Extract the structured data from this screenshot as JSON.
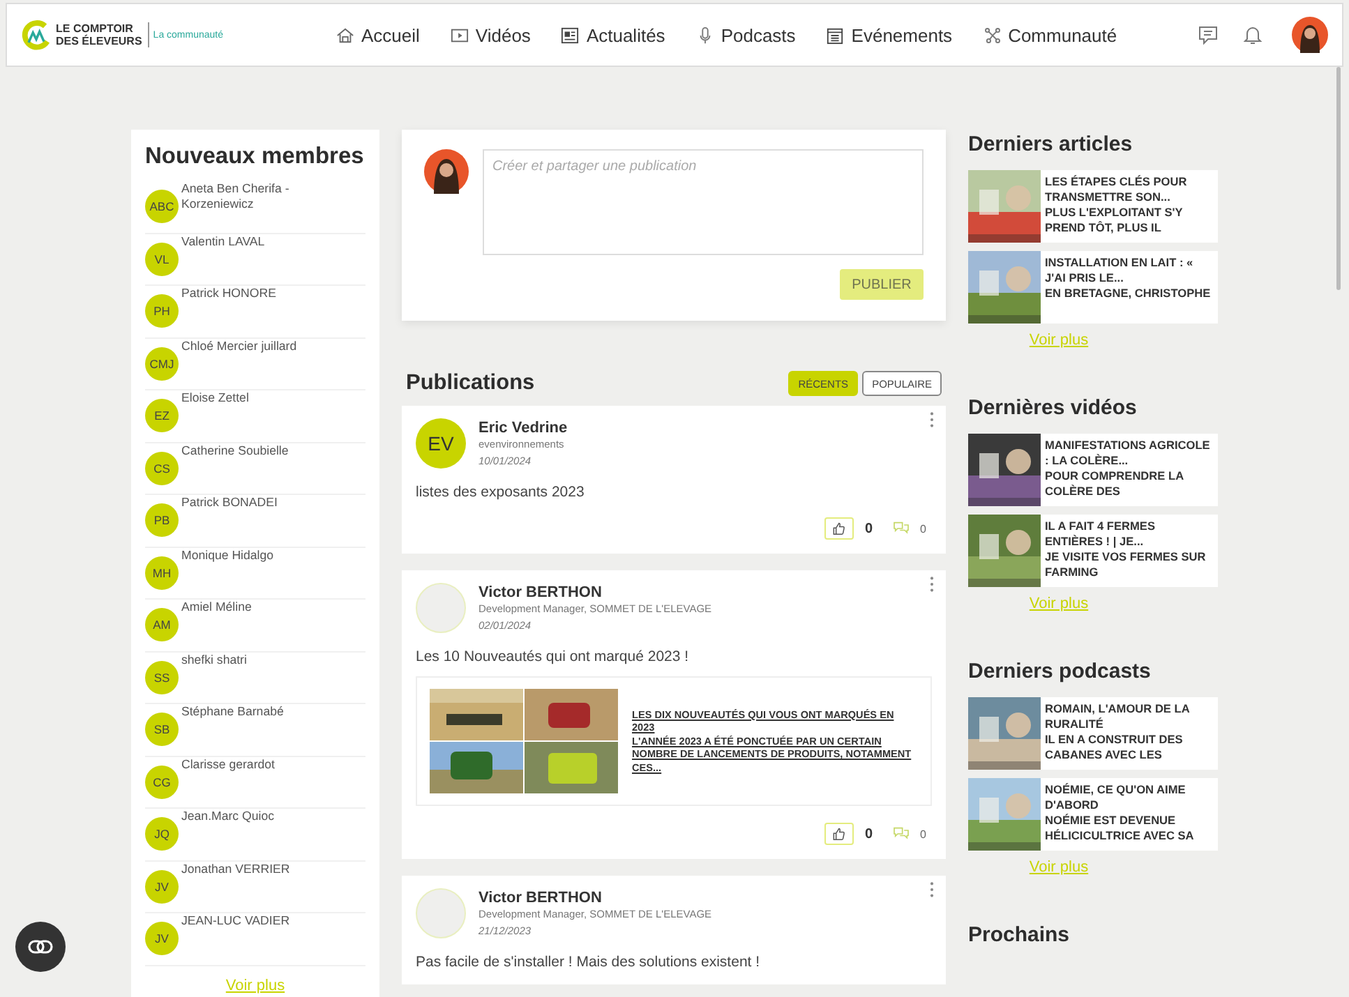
{
  "header": {
    "logo": {
      "line1": "LE COMPTOIR",
      "line2": "DES ÉLEVEURS",
      "tagline": "La communauté"
    },
    "nav": [
      {
        "label": "Accueil",
        "kind": "home"
      },
      {
        "label": "Vidéos",
        "kind": "video"
      },
      {
        "label": "Actualités",
        "kind": "news"
      },
      {
        "label": "Podcasts",
        "kind": "mic"
      },
      {
        "label": "Evénements",
        "kind": "calendar"
      },
      {
        "label": "Communauté",
        "kind": "network"
      }
    ]
  },
  "new_members": {
    "title": "Nouveaux membres",
    "more": "Voir plus",
    "items": [
      {
        "initials": "ABC",
        "name": "Aneta Ben Cherifa - Korzeniewicz"
      },
      {
        "initials": "VL",
        "name": "Valentin LAVAL"
      },
      {
        "initials": "PH",
        "name": "Patrick HONORE"
      },
      {
        "initials": "CMJ",
        "name": "Chloé Mercier juillard"
      },
      {
        "initials": "EZ",
        "name": "Eloise Zettel"
      },
      {
        "initials": "CS",
        "name": "Catherine Soubielle"
      },
      {
        "initials": "PB",
        "name": "Patrick BONADEI"
      },
      {
        "initials": "MH",
        "name": "Monique Hidalgo"
      },
      {
        "initials": "AM",
        "name": "Amiel Méline"
      },
      {
        "initials": "SS",
        "name": "shefki shatri"
      },
      {
        "initials": "SB",
        "name": "Stéphane Barnabé"
      },
      {
        "initials": "CG",
        "name": "Clarisse gerardot"
      },
      {
        "initials": "JQ",
        "name": "Jean.Marc Quioc"
      },
      {
        "initials": "JV",
        "name": "Jonathan VERRIER"
      },
      {
        "initials": "JV",
        "name": "JEAN-LUC VADIER"
      }
    ]
  },
  "composer": {
    "placeholder": "Créer et partager une publication",
    "button": "PUBLIER"
  },
  "publications": {
    "title": "Publications",
    "filters": [
      {
        "label": "RÉCENTS",
        "selected": true
      },
      {
        "label": "POPULAIRE",
        "selected": false
      }
    ],
    "posts": [
      {
        "kind": "initials",
        "initials": "EV",
        "author": "Eric Vedrine",
        "subtitle": "evenvironnements",
        "date": "10/01/2024",
        "text": "listes des exposants 2023",
        "likes": "0",
        "comments": "0"
      },
      {
        "kind": "blank",
        "author": "Victor BERTHON",
        "subtitle": "Development Manager, SOMMET DE L'ELEVAGE",
        "date": "02/01/2024",
        "text": "Les 10 Nouveautés qui ont marqué 2023 !",
        "link": {
          "kind": "picture",
          "title": "LES DIX NOUVEAUTÉS QUI VOUS ONT MARQUÉS EN 2023",
          "excerpt": "L'ANNÉE 2023 A ÉTÉ PONCTUÉE PAR UN CERTAIN NOMBRE DE LANCEMENTS DE PRODUITS, NOTAMMENT CES..."
        },
        "likes": "0",
        "comments": "0"
      },
      {
        "kind": "blank",
        "author": "Victor BERTHON",
        "subtitle": "Development Manager, SOMMET DE L'ELEVAGE",
        "date": "21/12/2023",
        "text": "Pas facile de s'installer ! Mais des solutions existent !"
      }
    ]
  },
  "sidebar": [
    {
      "title": "Derniers articles",
      "more": "Voir plus",
      "items": [
        {
          "kind": "picture",
          "title": "LES ÉTAPES CLÉS POUR TRANSMETTRE SON...",
          "excerpt": "PLUS L'EXPLOITANT S'Y PREND TÔT, PLUS IL"
        },
        {
          "kind": "picture",
          "title": "INSTALLATION EN LAIT : « J'AI PRIS LE...",
          "excerpt": "EN BRETAGNE, CHRISTOPHE"
        }
      ]
    },
    {
      "title": "Dernières vidéos",
      "more": "Voir plus",
      "items": [
        {
          "kind": "picture",
          "title": "MANIFESTATIONS AGRICOLE : LA COLÈRE...",
          "excerpt": "POUR COMPRENDRE LA COLÈRE DES"
        },
        {
          "kind": "picture",
          "title": "IL A FAIT 4 FERMES ENTIÈRES ! | JE...",
          "excerpt": "JE VISITE VOS FERMES SUR FARMING"
        }
      ]
    },
    {
      "title": "Derniers podcasts",
      "more": "Voir plus",
      "items": [
        {
          "kind": "picture",
          "title": "ROMAIN, L'AMOUR DE LA RURALITÉ",
          "excerpt": "IL EN A CONSTRUIT DES CABANES AVEC LES"
        },
        {
          "kind": "picture",
          "title": "NOÉMIE, CE QU'ON AIME D'ABORD",
          "excerpt": "NOÉMIE EST DEVENUE HÉLICICULTRICE AVEC SA"
        }
      ]
    },
    {
      "title": "Prochains"
    }
  ]
}
